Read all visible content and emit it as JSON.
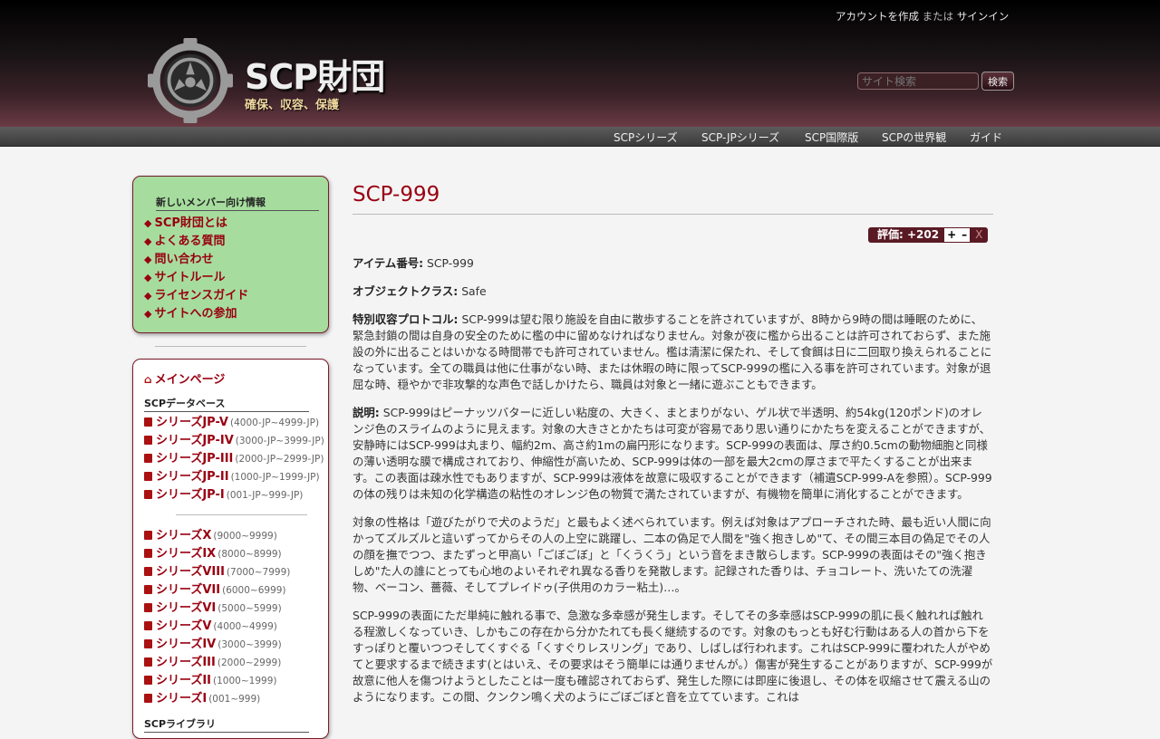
{
  "header": {
    "account": {
      "create": "アカウントを作成",
      "or": "または",
      "signin": "サインイン"
    },
    "site_title": "SCP財団",
    "tagline": "確保、収容、保護",
    "search": {
      "placeholder": "サイト検索",
      "button": "検索"
    }
  },
  "topnav": [
    "SCPシリーズ",
    "SCP-JPシリーズ",
    "SCP国際版",
    "SCPの世界観",
    "ガイド"
  ],
  "sidebar": {
    "newbox_title": "新しいメンバー向け情報",
    "newbox_links": [
      "SCP財団とは",
      "よくある質問",
      "問い合わせ",
      "サイトルール",
      "ライセンスガイド",
      "サイトへの参加"
    ],
    "main_page": "メインページ",
    "database_title": "SCPデータベース",
    "jp_series": [
      {
        "label": "シリーズJP-V",
        "range": "(4000-JP~4999-JP)"
      },
      {
        "label": "シリーズJP-IV",
        "range": "(3000-JP~3999-JP)"
      },
      {
        "label": "シリーズJP-III",
        "range": "(2000-JP~2999-JP)"
      },
      {
        "label": "シリーズJP-II",
        "range": "(1000-JP~1999-JP)"
      },
      {
        "label": "シリーズJP-I",
        "range": "(001-JP~999-JP)"
      }
    ],
    "series": [
      {
        "label": "シリーズX",
        "range": "(9000~9999)"
      },
      {
        "label": "シリーズIX",
        "range": "(8000~8999)"
      },
      {
        "label": "シリーズVIII",
        "range": "(7000~7999)"
      },
      {
        "label": "シリーズVII",
        "range": "(6000~6999)"
      },
      {
        "label": "シリーズVI",
        "range": "(5000~5999)"
      },
      {
        "label": "シリーズV",
        "range": "(4000~4999)"
      },
      {
        "label": "シリーズIV",
        "range": "(3000~3999)"
      },
      {
        "label": "シリーズIII",
        "range": "(2000~2999)"
      },
      {
        "label": "シリーズII",
        "range": "(1000~1999)"
      },
      {
        "label": "シリーズI",
        "range": "(001~999)"
      }
    ],
    "library_title": "SCPライブラリ"
  },
  "page": {
    "title": "SCP-999",
    "rating": {
      "label": "評価: +202",
      "plus": "+",
      "minus": "–",
      "close": "X"
    },
    "item_label": "アイテム番号:",
    "item_value": "SCP-999",
    "class_label": "オブジェクトクラス:",
    "class_value": "Safe",
    "procedures_label": "特別収容プロトコル:",
    "procedures_text": "SCP-999は望む限り施設を自由に散歩することを許されていますが、8時から9時の間は睡眠のために、緊急封鎖の間は自身の安全のために檻の中に留めなければなりません。対象が夜に檻から出ることは許可されておらず、また施設の外に出ることはいかなる時間帯でも許可されていません。檻は清潔に保たれ、そして食餌は日に二回取り換えられることになっています。全ての職員は他に仕事がない時、または休暇の時に限ってSCP-999の檻に入る事を許可されています。対象が退屈な時、穏やかで非攻撃的な声色で話しかけたら、職員は対象と一緒に遊ぶこともできます。",
    "description_label": "説明:",
    "description_text": "SCP-999はピーナッツバターに近しい粘度の、大きく、まとまりがない、ゲル状で半透明、約54kg(120ポンド)のオレンジ色のスライムのように見えます。対象の大きさとかたちは可変が容易であり思い通りにかたちを変えることができますが、安静時にはSCP-999は丸まり、幅約2m、高さ約1mの扁円形になります。SCP-999の表面は、厚さ約0.5cmの動物細胞と同様の薄い透明な膜で構成されており、伸縮性が高いため、SCP-999は体の一部を最大2cmの厚さまで平たくすることが出来ます。この表面は疎水性でもありますが、SCP-999は液体を故意に吸収することができます（補遺SCP-999-Aを参照）。SCP-999の体の残りは未知の化学構造の粘性のオレンジ色の物質で満たされていますが、有機物を簡単に消化することができます。",
    "paragraph3": "対象の性格は「遊びたがりで犬のようだ」と最もよく述べられています。例えば対象はアプローチされた時、最も近い人間に向かってズルズルと這いずってからその人の上空に跳躍し、二本の偽足で人間を\"強く抱きしめ\"て、その間三本目の偽足でその人の顔を撫でつつ、またずっと甲高い「ごぼごぼ」と「くうくう」という音をまき散らします。SCP-999の表面はその\"強く抱きしめ\"た人の誰にとっても心地のよいそれぞれ異なる香りを発散します。記録された香りは、チョコレート、洗いたての洗濯物、ベーコン、薔薇、そしてプレイドゥ(子供用のカラー粘土)…。",
    "paragraph4": "SCP-999の表面にただ単純に触れる事で、急激な多幸感が発生します。そしてその多幸感はSCP-999の肌に長く触れれば触れる程激しくなっていき、しかもこの存在から分かたれても長く継続するのです。対象のもっとも好む行動はある人の首から下をすっぽりと覆いつつそしてくすぐる「くすぐりレスリング」であり、しばしば行われます。これはSCP-999に覆われた人がやめてと要求するまで続きます(とはいえ、その要求はそう簡単には通りませんが。）傷害が発生することがありますが、SCP-999が故意に他人を傷つけようとしたことは一度も確認されておらず、発生した際には即座に後退し、その体を収縮させて震える山のようになります。この間、クンクン鳴く犬のようにごぼごぼと音を立てています。これは"
  },
  "colors": {
    "accent": "#990011",
    "newbox_bg": "#a6dd9e",
    "topnav": "#4a4a4a"
  },
  "icons": [
    "scp-logo-icon",
    "diamond-bullet-icon",
    "home-icon",
    "page-icon"
  ]
}
